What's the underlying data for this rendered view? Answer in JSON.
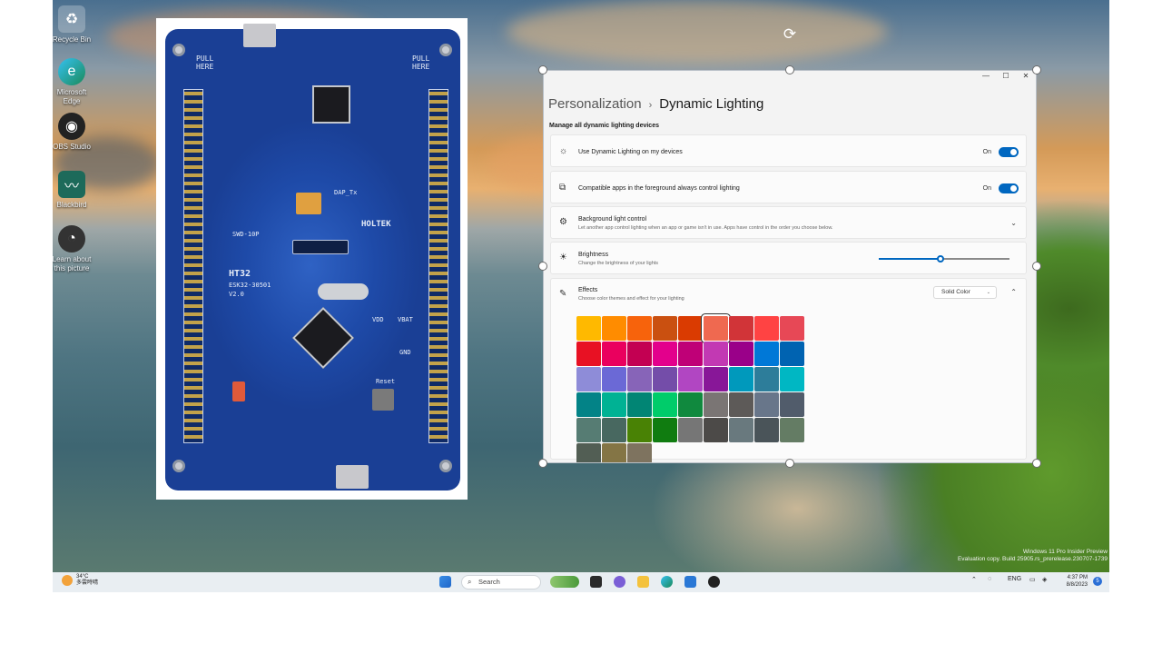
{
  "desktop": {
    "icons": [
      {
        "label": "Recycle Bin",
        "icon": "recycle-bin-icon"
      },
      {
        "label": "Microsoft Edge",
        "icon": "edge-icon"
      },
      {
        "label": "OBS Studio",
        "icon": "obs-icon"
      },
      {
        "label": "Blackbird",
        "icon": "monitor-app-icon"
      },
      {
        "label": "Learn about this picture",
        "icon": "camera-icon"
      }
    ],
    "watermark": {
      "line1": "Windows 11 Pro Insider Preview",
      "line2": "Evaluation copy. Build 25905.rs_prerelease.230707-1739"
    }
  },
  "pcb": {
    "pull_left": "PULL HERE",
    "pull_right": "PULL HERE",
    "brand": "HOLTEK",
    "model": "HT32",
    "board": "ESK32-30501",
    "version": "V2.0",
    "reset": "Reset",
    "gnd": "GND",
    "swd": "SWD-10P",
    "dap": "DAP_Tx",
    "vdd": "VDD",
    "vbat": "VBAT"
  },
  "settings": {
    "window_controls": {
      "minimize": "—",
      "maximize": "☐",
      "close": "✕"
    },
    "breadcrumb": {
      "parent": "Personalization",
      "separator": "›",
      "current": "Dynamic Lighting"
    },
    "section_title": "Manage all dynamic lighting devices",
    "rows": [
      {
        "title": "Use Dynamic Lighting on my devices",
        "state": "On",
        "icon": "sun-icon"
      },
      {
        "title": "Compatible apps in the foreground always control lighting",
        "state": "On",
        "icon": "apps-icon"
      },
      {
        "title": "Background light control",
        "subtitle": "Let another app control lighting when an app or game isn't in use. Apps have control in the order you choose below.",
        "icon": "gear-icon"
      },
      {
        "title": "Brightness",
        "subtitle": "Change the brightness of your lights",
        "icon": "brightness-icon",
        "level": 0.47
      },
      {
        "title": "Effects",
        "subtitle": "Choose color themes and effect for your lighting",
        "icon": "pen-icon",
        "effect": "Solid Color"
      }
    ],
    "swatch_rows": [
      [
        "#ffb900",
        "#ff8c00",
        "#f7630c",
        "#ca5010",
        "#da3b01",
        "#ef6950",
        "#d13438",
        "#ff4343",
        "#e74856"
      ],
      [
        "#e81123",
        "#ea005e",
        "#c30052",
        "#e3008c",
        "#bf0077",
        "#c239b3",
        "#9a0089",
        "#0078d7",
        "#0063b1"
      ],
      [
        "#8e8cd8",
        "#6b69d6",
        "#8764b8",
        "#744da9",
        "#b146c2",
        "#881798",
        "#0099bc",
        "#2d7d9a",
        "#00b7c3"
      ],
      [
        "#038387",
        "#00b294",
        "#018574",
        "#00cc6a",
        "#10893e",
        "#7a7574",
        "#5d5a58",
        "#68768a",
        "#515c6b"
      ],
      [
        "#567c73",
        "#486860",
        "#498205",
        "#107c10",
        "#767676",
        "#4c4a48",
        "#69797e",
        "#4a5459",
        "#647c64"
      ],
      [
        "#525e54",
        "#847545",
        "#7e735f"
      ]
    ],
    "selected_swatch": "#ef6950"
  },
  "taskbar": {
    "weather_temp": "34°C",
    "weather_desc": "多雲時晴",
    "search_placeholder": "Search",
    "language": "ENG",
    "time": "4:37 PM",
    "date": "8/8/2023",
    "notification_count": "5",
    "apps": [
      "start-icon",
      "widgets-icon",
      "task-view-icon",
      "chat-icon",
      "file-explorer-icon",
      "edge-icon",
      "store-icon",
      "obs-icon"
    ]
  }
}
